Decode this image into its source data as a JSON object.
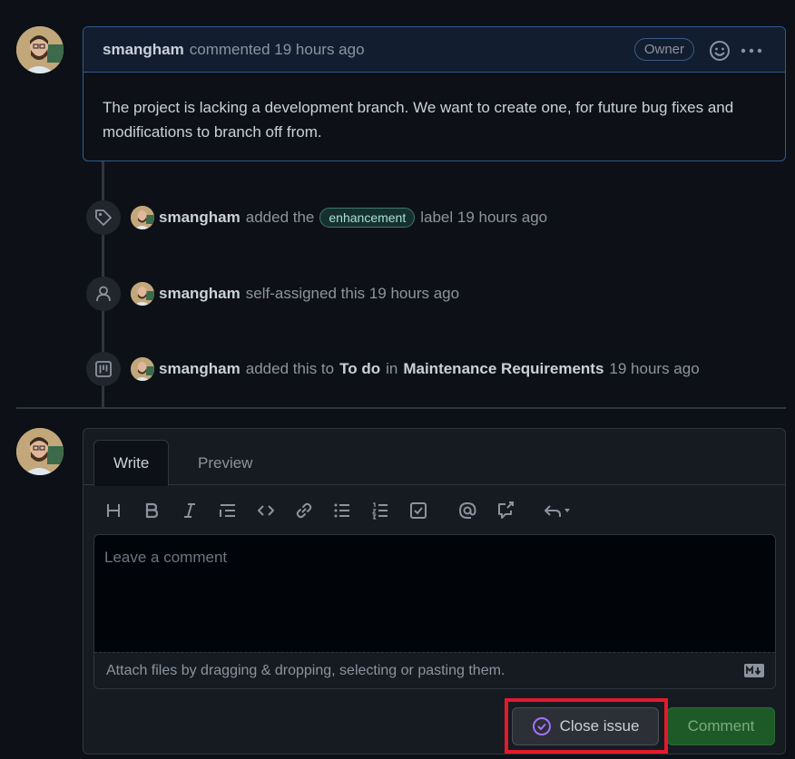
{
  "comment": {
    "author": "smangham",
    "meta": "commented 19 hours ago",
    "badge": "Owner",
    "body": "The project is lacking a development branch. We want to create one, for future bug fixes and modifications to branch off from."
  },
  "events": [
    {
      "icon": "tag-icon",
      "author": "smangham",
      "pre": "added the",
      "label": "enhancement",
      "post": "label 19 hours ago"
    },
    {
      "icon": "person-icon",
      "author": "smangham",
      "text": "self-assigned this 19 hours ago"
    },
    {
      "icon": "project-icon",
      "author": "smangham",
      "pre": "added this to",
      "column": "To do",
      "mid": "in",
      "project": "Maintenance Requirements",
      "post": "19 hours ago"
    }
  ],
  "form": {
    "tabs": [
      "Write",
      "Preview"
    ],
    "placeholder": "Leave a comment",
    "attach_text": "Attach files by dragging & dropping, selecting or pasting them.",
    "close_label": "Close issue",
    "comment_label": "Comment",
    "toolbar": [
      "heading-icon",
      "bold-icon",
      "italic-icon",
      "quote-icon",
      "code-icon",
      "link-icon",
      "bulleted-list-icon",
      "numbered-list-icon",
      "task-list-icon",
      "mention-icon",
      "cross-reference-icon",
      "reply-icon"
    ]
  },
  "colors": {
    "background": "#0d1117",
    "comment_border": "#2f5a8f",
    "label_bg": "#16302e",
    "label_text": "#a5e1db",
    "highlight": "#e21a2c",
    "comment_button": "#1e5a28",
    "close_icon": "#a371f7"
  }
}
